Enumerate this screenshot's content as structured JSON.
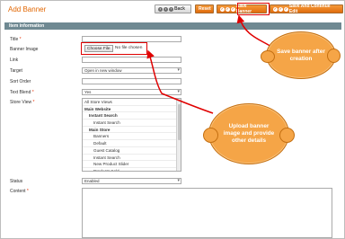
{
  "page": {
    "title": "Add Banner"
  },
  "toolbar": {
    "back_label": "Back",
    "reset_label": "Reset",
    "save_label": "Save Banner",
    "save_continue_label": "Save And Continue Edit"
  },
  "section": {
    "title": "Item information"
  },
  "form": {
    "title_label": "Title",
    "title_value": "",
    "image_label": "Banner Image",
    "choose_file_label": "Choose File",
    "no_file_text": "No file chosen",
    "link_label": "Link",
    "target_label": "Target",
    "target_value": "Open in new window",
    "sort_label": "Sort Order",
    "text_blend_label": "Text Blend",
    "text_blend_value": "Yes",
    "store_view_label": "Store View",
    "store_views": [
      {
        "label": "All Store Views",
        "bold": false,
        "indent": 0
      },
      {
        "label": "Main Website",
        "bold": true,
        "indent": 0
      },
      {
        "label": "Instant Search",
        "bold": true,
        "indent": 1
      },
      {
        "label": "Instant Search",
        "bold": false,
        "indent": 2
      },
      {
        "label": "Main Store",
        "bold": true,
        "indent": 1
      },
      {
        "label": "Banners",
        "bold": false,
        "indent": 2
      },
      {
        "label": "Default",
        "bold": false,
        "indent": 2
      },
      {
        "label": "Guest Catalog",
        "bold": false,
        "indent": 2
      },
      {
        "label": "Instant Search",
        "bold": false,
        "indent": 2
      },
      {
        "label": "New Product Slider",
        "bold": false,
        "indent": 2
      },
      {
        "label": "Products Sold",
        "bold": false,
        "indent": 2
      }
    ],
    "status_label": "Status",
    "status_value": "Enabled",
    "content_label": "Content",
    "required_mark": "*"
  },
  "callouts": {
    "save": "Save banner after creation",
    "upload": "Upload banner image and provide other details"
  },
  "colors": {
    "accent": "#e26703",
    "section_bar": "#6f8992",
    "highlight": "#e00000",
    "callout": "#f5a547"
  }
}
